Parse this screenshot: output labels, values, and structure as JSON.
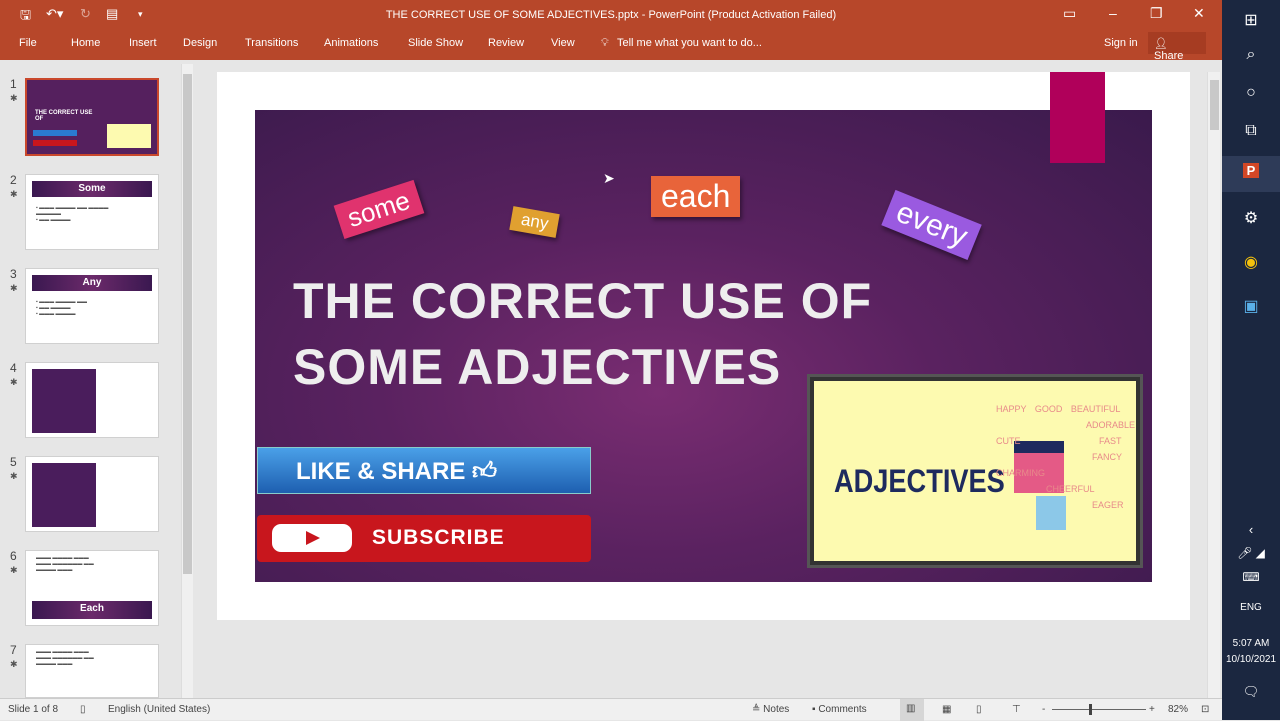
{
  "window": {
    "title": "THE CORRECT USE OF SOME ADJECTIVES.pptx - PowerPoint (Product Activation Failed)",
    "sign_in": "Sign in",
    "share": "Share"
  },
  "ribbon": {
    "tabs": [
      "File",
      "Home",
      "Insert",
      "Design",
      "Transitions",
      "Animations",
      "Slide Show",
      "Review",
      "View"
    ],
    "tell_me": "Tell me what you want to do..."
  },
  "thumbnails": [
    {
      "num": "1"
    },
    {
      "num": "2",
      "header": "Some"
    },
    {
      "num": "3",
      "header": "Any"
    },
    {
      "num": "4"
    },
    {
      "num": "5"
    },
    {
      "num": "6",
      "header": "Each"
    },
    {
      "num": "7"
    }
  ],
  "slide": {
    "tags": [
      "some",
      "any",
      "each",
      "every"
    ],
    "title_line1": "THE CORRECT USE OF",
    "title_line2": "SOME ADJECTIVES",
    "like_share": "LIKE & SHARE",
    "subscribe": "SUBSCRIBE",
    "image_text": "ADJECTIVES",
    "image_words": [
      "HAPPY",
      "GOOD",
      "BEAUTIFUL",
      "ADORABLE",
      "CUTE",
      "FAST",
      "FANCY",
      "CHARMING",
      "CHEERFUL",
      "EAGER"
    ]
  },
  "status": {
    "slide": "Slide 1 of 8",
    "language": "English (United States)",
    "notes": "Notes",
    "comments": "Comments",
    "zoom": "82%",
    "zoom_level": 82
  },
  "taskbar": {
    "lang": "ENG",
    "time": "5:07 AM",
    "date": "10/10/2021"
  },
  "colors": {
    "ribbon": "#b7472a",
    "slide_bg": "#5a2260",
    "accent_magenta": "#b0005a"
  }
}
